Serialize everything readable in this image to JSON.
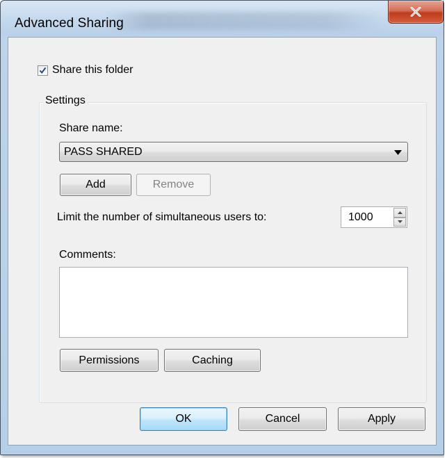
{
  "window": {
    "title": "Advanced Sharing",
    "close_glyph": "X"
  },
  "share_checkbox": {
    "label": "Share this folder",
    "checked": true
  },
  "settings": {
    "group_title": "Settings",
    "share_name_label": "Share name:",
    "share_name_value": "PASS SHARED",
    "add_label": "Add",
    "remove_label": "Remove",
    "limit_label": "Limit the number of simultaneous users to:",
    "limit_value": "1000",
    "comments_label": "Comments:",
    "comments_value": "",
    "permissions_label": "Permissions",
    "caching_label": "Caching"
  },
  "footer": {
    "ok_label": "OK",
    "cancel_label": "Cancel",
    "apply_label": "Apply"
  },
  "icons": {
    "close": "close-icon",
    "check": "checkmark-icon",
    "dropdown": "chevron-down-icon",
    "spin_up": "spin-up-icon",
    "spin_down": "spin-down-icon"
  },
  "colors": {
    "close_button": "#c8462a",
    "default_button_border": "#3c7fb1",
    "dialog_background": "#f0f0f0",
    "frame": "#bcd3ea"
  }
}
